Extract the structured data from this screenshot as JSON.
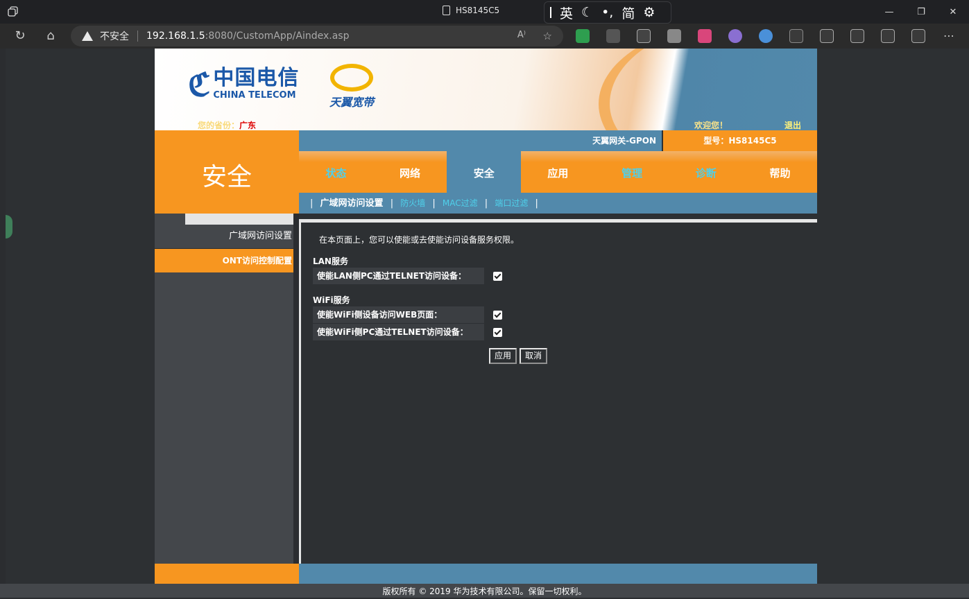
{
  "browser": {
    "tab_title": "HS8145C5",
    "ime": {
      "lang": "英",
      "punct": "•,",
      "script": "简"
    },
    "security_label": "不安全",
    "url_host": "192.168.1.5",
    "url_rest": ":8080/CustomApp/Aindex.asp",
    "window_controls": [
      "—",
      "❐",
      "✕"
    ]
  },
  "banner": {
    "brand_cn": "中国电信",
    "brand_en": "CHINA TELECOM",
    "sub_brand": "天翼宽带",
    "province_label": "您的省份：",
    "province": "广东",
    "welcome": "欢迎您！",
    "logout": "退出"
  },
  "header": {
    "section_title": "安全",
    "gateway": "天翼网关-GPON",
    "model": "型号：HS8145C5"
  },
  "menu": [
    {
      "label": "状态"
    },
    {
      "label": "网络"
    },
    {
      "label": "安全"
    },
    {
      "label": "应用"
    },
    {
      "label": "管理"
    },
    {
      "label": "诊断"
    },
    {
      "label": "帮助"
    }
  ],
  "submenu": {
    "current": "广域网访问设置",
    "links": [
      "防火墙",
      "MAC过滤",
      "端口过滤"
    ]
  },
  "leftnav": [
    {
      "label": "广域网访问设置"
    },
    {
      "label": "ONT访问控制配置"
    }
  ],
  "content": {
    "intro": "在本页面上，您可以使能或去使能访问设备服务权限。",
    "lan_title": "LAN服务",
    "lan_telnet": "使能LAN侧PC通过TELNET访问设备：",
    "lan_telnet_checked": true,
    "wifi_title": "WiFi服务",
    "wifi_web": "使能WiFi侧设备访问WEB页面：",
    "wifi_web_checked": true,
    "wifi_telnet": "使能WiFi侧PC通过TELNET访问设备：",
    "wifi_telnet_checked": true,
    "apply": "应用",
    "cancel": "取消"
  },
  "footer": "版权所有 © 2019 华为技术有限公司。保留一切权利。"
}
